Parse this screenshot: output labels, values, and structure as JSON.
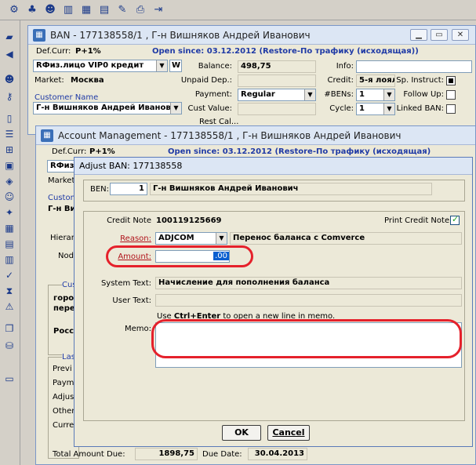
{
  "toolbar": {
    "icons": [
      "settings-icon",
      "user-icon",
      "agent-icon",
      "book-icon",
      "table-icon",
      "document-icon",
      "pen-icon",
      "print-icon",
      "exit-icon"
    ]
  },
  "ban_window": {
    "title": "BAN - 177138558/1 , Г-н Вишняков Андрей Иванович",
    "def_curr_label": "Def.Curr:",
    "def_curr": "P+1%",
    "open_since": "Open since: 03.12.2012 (Restore-По трафику (исходящая))",
    "account_type": "RФиз.лицо  VIP0  кредит",
    "w_label": "W",
    "market_label": "Market:",
    "market": "Москва",
    "customer_name_label": "Customer Name",
    "customer_name": "Г-н Вишняков Андрей Иванові",
    "balance_label": "Balance:",
    "balance": "498,75",
    "unpaid_label": "Unpaid Dep.:",
    "unpaid": "",
    "payment_label": "Payment:",
    "payment": "Regular",
    "cust_value_label": "Cust Value:",
    "cust_value": "",
    "info_label": "Info:",
    "info": "",
    "credit_label": "Credit:",
    "credit": "5-я лоял",
    "bens_label": "#BENs:",
    "bens": "1",
    "cycle_label": "Cycle:",
    "cycle": "1",
    "sp_instruct_label": "Sp. Instruct:",
    "follow_up_label": "Follow Up:",
    "linked_ban_label": "Linked BAN:",
    "partial_text": "Rest Cal..."
  },
  "am_window": {
    "title": "Account Management - 177138558/1 , Г-н Вишняков Андрей Иванович",
    "def_curr_label": "Def.Curr:",
    "def_curr": "P+1%",
    "open_since": "Open since: 03.12.2012 (Restore-По трафику (исходящая)",
    "account_type": "RФиз.",
    "market_label": "Market",
    "custom_label": "Custom",
    "g_vi": "Г-н Ви",
    "hierar_label": "Hierar",
    "nod_label": "Nod",
    "cus_label": "Cus",
    "goro": "горо",
    "pere": "пере",
    "ross": "Росс",
    "las_label": "Las",
    "previ_label": "Previ",
    "paym_label": "Paym",
    "adjus_label": "Adjus",
    "other_label": "Other",
    "curre_label": "Curre",
    "total_due_label": "Total Amount Due:",
    "total_due": "1898,75",
    "due_date_label": "Due Date:",
    "due_date": "30.04.2013"
  },
  "dialog": {
    "title": "Adjust BAN: 177138558",
    "ben_label": "BEN:",
    "ben": "1",
    "ben_name": "Г-н Вишняков Андрей Иванович",
    "credit_note_label": "Credit Note",
    "credit_note": "100119125669",
    "print_credit_note_label": "Print Credit Note",
    "reason_label": "Reason:",
    "reason_code": "ADJCOM",
    "reason_desc": "Перенос баланса с Comverce",
    "amount_label": "Amount:",
    "amount": ".00",
    "system_text_label": "System Text:",
    "system_text": "Начисление для пополнения баланса",
    "user_text_label": "User Text:",
    "user_text": "",
    "hint_pre": "Use ",
    "hint_key": "Ctrl+Enter",
    "hint_post": " to open a new line in memo.",
    "memo_label": "Memo:",
    "memo": "",
    "ok_label": "OK",
    "cancel_label": "Cancel"
  },
  "colors": {
    "annotation": "#e5212b",
    "link_blue": "#1f3aa6",
    "highlight": "#0a5fd0"
  }
}
